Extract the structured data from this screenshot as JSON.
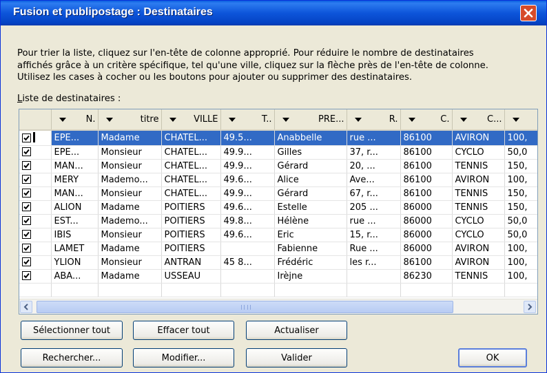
{
  "window": {
    "title": "Fusion et publipostage : Destinataires"
  },
  "instructions": {
    "line1": "Pour trier la liste, cliquez sur l'en-tête de colonne approprié. Pour réduire le nombre de destinataires",
    "line2": "affichés grâce à un critère spécifique, tel qu'une ville, cliquez sur la flèche près de l'en-tête de colonne.",
    "line3": "Utilisez les cases à cocher ou les boutons pour ajouter ou supprimer des destinataires."
  },
  "list": {
    "label": "Liste de destinataires :",
    "columns": [
      "N.",
      "titre",
      "VILLE",
      "T..",
      "PRE...",
      "R.",
      "C.",
      "C...",
      ""
    ],
    "rows": [
      {
        "checked": true,
        "selected": true,
        "cells": [
          "EPE...",
          "Madame",
          "CHATEL...",
          "49.5...",
          "Anabbelle",
          "rue ...",
          "86100",
          "AVIRON",
          "100,"
        ]
      },
      {
        "checked": true,
        "selected": false,
        "cells": [
          "EPE...",
          "Monsieur",
          "CHATEL...",
          "49.9...",
          "Gilles",
          "37, r...",
          "86100",
          "CYCLO",
          "50,0"
        ]
      },
      {
        "checked": true,
        "selected": false,
        "cells": [
          "MAN...",
          "Monsieur",
          "CHATEL...",
          "49.9...",
          "Gérard",
          "20, ...",
          "86100",
          "TENNIS",
          "150,"
        ]
      },
      {
        "checked": true,
        "selected": false,
        "cells": [
          "MERY",
          "Mademo...",
          "CHATEL...",
          "49.6...",
          "Alice",
          "Ave...",
          "86100",
          "AVIRON",
          "100,"
        ]
      },
      {
        "checked": true,
        "selected": false,
        "cells": [
          "MAN...",
          "Monsieur",
          "CHATEL...",
          "49.9...",
          "Gérard",
          "67, r...",
          "86100",
          "TENNIS",
          "150,"
        ]
      },
      {
        "checked": true,
        "selected": false,
        "cells": [
          "ALION",
          "Madame",
          "POITIERS",
          "49.6...",
          "Estelle",
          "205 ...",
          "86000",
          "TENNIS",
          "150,"
        ]
      },
      {
        "checked": true,
        "selected": false,
        "cells": [
          "EST...",
          "Mademo...",
          "POITIERS",
          "49.8...",
          "Hélène",
          "rue ...",
          "86000",
          "CYCLO",
          "50,0"
        ]
      },
      {
        "checked": true,
        "selected": false,
        "cells": [
          "IBIS",
          "Monsieur",
          "POITIERS",
          "49.6...",
          "Eric",
          "15, r...",
          "86000",
          "CYCLO",
          "50,0"
        ]
      },
      {
        "checked": true,
        "selected": false,
        "cells": [
          "LAMET",
          "Madame",
          "POITIERS",
          "",
          "Fabienne",
          "Rue ...",
          "86000",
          "AVIRON",
          "100,"
        ]
      },
      {
        "checked": true,
        "selected": false,
        "cells": [
          "YLION",
          "Monsieur",
          "ANTRAN",
          "45 8...",
          "Frédéric",
          "les r...",
          "86100",
          "AVIRON",
          "100,"
        ]
      },
      {
        "checked": true,
        "selected": false,
        "cells": [
          "ABA...",
          "Madame",
          "USSEAU",
          "",
          "Irèjne",
          "",
          "86230",
          "TENNIS",
          "100,"
        ]
      },
      {
        "checked": false,
        "selected": false,
        "cells": [
          "",
          "",
          "",
          "",
          "",
          "",
          "",
          "",
          ""
        ]
      }
    ]
  },
  "buttons": {
    "select_all": "Sélectionner tout",
    "clear_all": "Effacer tout",
    "refresh": "Actualiser",
    "search": "Rechercher...",
    "modify": "Modifier...",
    "validate": "Valider",
    "ok": "OK"
  },
  "colors": {
    "titlebar": "#0a5fe0",
    "selection": "#316ac5",
    "close_button": "#d64b2a",
    "dialog_bg": "#ece9d8"
  }
}
